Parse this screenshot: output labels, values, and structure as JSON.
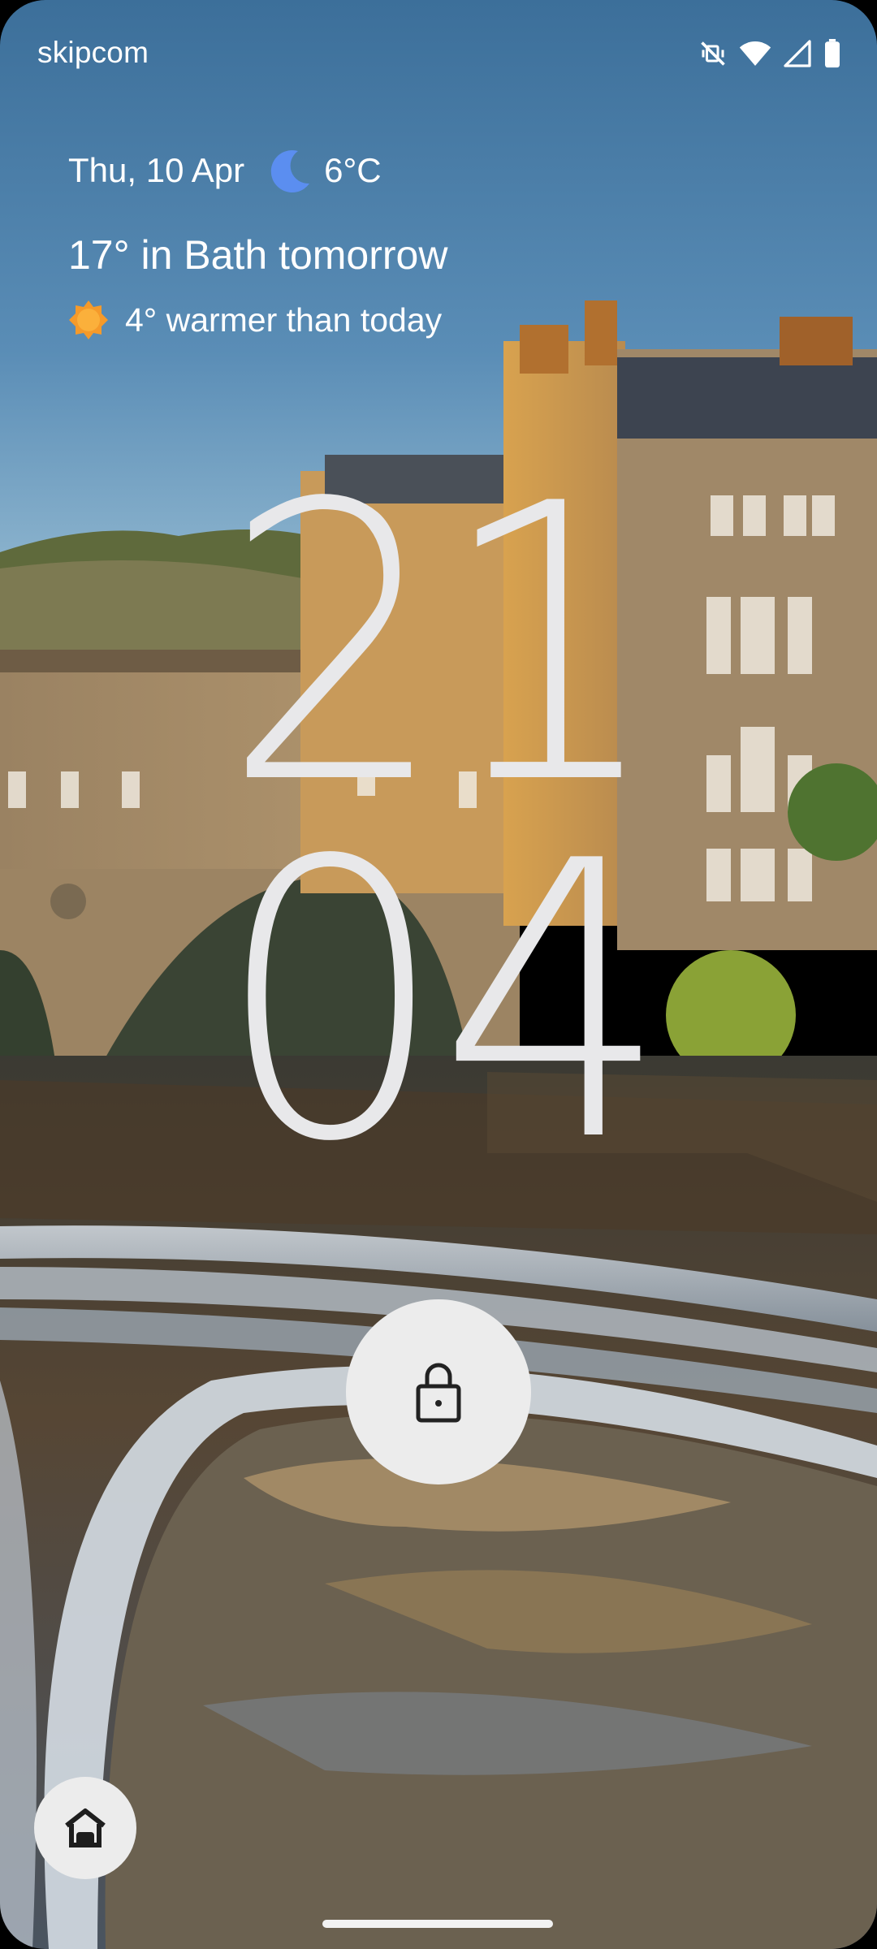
{
  "status_bar": {
    "carrier": "skipcom",
    "icons": [
      "vibrate-mute-icon",
      "wifi-icon",
      "cellular-signal-icon",
      "battery-icon"
    ]
  },
  "glance": {
    "date": "Thu, 10 Apr",
    "current_weather_icon": "moon-icon",
    "current_temp": "6°C",
    "forecast_title": "17° in Bath tomorrow",
    "forecast_icon": "sun-icon",
    "forecast_detail": "4° warmer than today"
  },
  "clock": {
    "hours": "21",
    "minutes": "04"
  },
  "lock": {
    "icon": "padlock-icon"
  },
  "shortcut": {
    "icon": "home-icon"
  },
  "colors": {
    "clock": "#e8e8ea",
    "button_bg": "#ececec",
    "moon": "#5b8ef0",
    "sun": "#f59a2a"
  }
}
